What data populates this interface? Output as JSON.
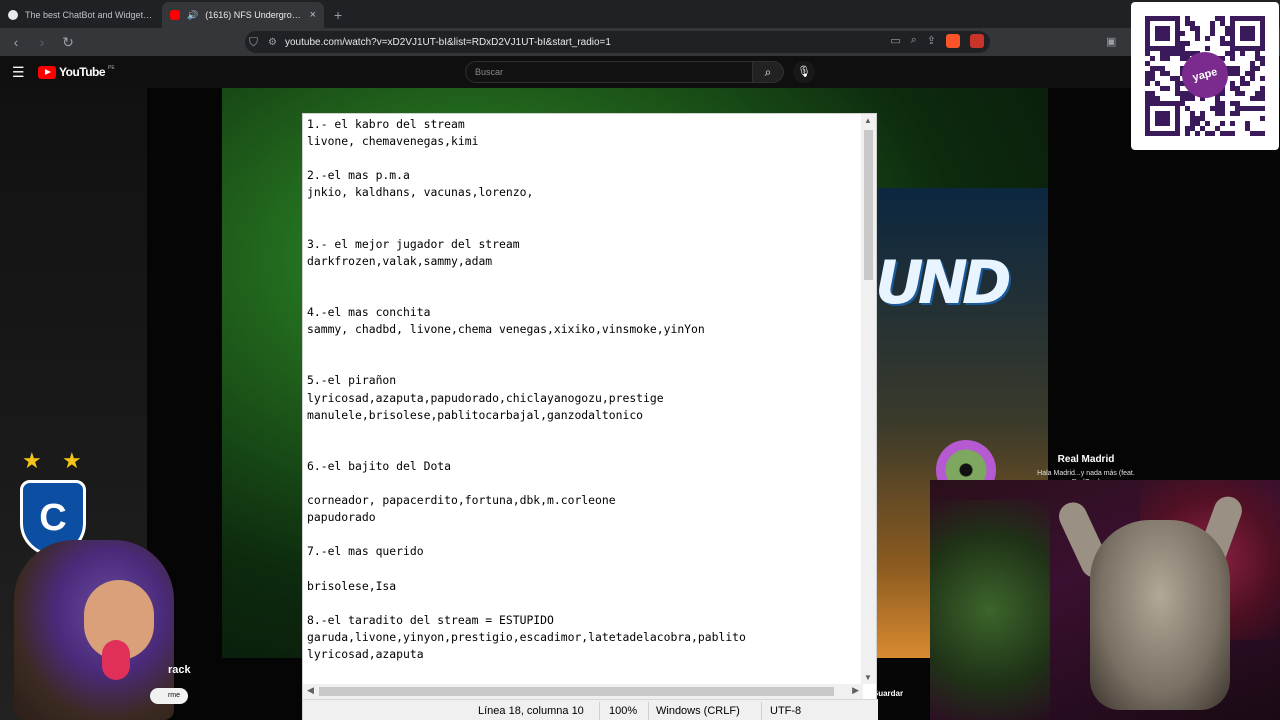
{
  "browser": {
    "tabs": [
      {
        "title": "The best ChatBot and Widgets for K",
        "favicon": "chatbot-icon"
      },
      {
        "title": "(1616) NFS Underground 2 -",
        "favicon": "youtube-icon",
        "audio": true
      }
    ],
    "new_tab": "+",
    "close": "×",
    "url": "youtube.com/watch?v=xD2VJ1UT-bI&list=RDxD2VJ1UT-bI&start_radio=1"
  },
  "youtube": {
    "logo_text": "YouTube",
    "logo_suffix": "PE",
    "search_placeholder": "Buscar"
  },
  "notepad": {
    "lines": [
      "1.- el kabro del stream",
      "livone, chemavenegas,kimi",
      "",
      "2.-el mas p.m.a",
      "jnkio, kaldhans, vacunas,lorenzo,",
      "",
      "",
      "3.- el mejor jugador del stream",
      "darkfrozen,valak,sammy,adam",
      "",
      "",
      "4.-el mas conchita",
      "sammy, chadbd, livone,chema venegas,xixiko,vinsmoke,yinYon",
      "",
      "",
      "5.-el pirañon",
      "lyricosad,azaputa,papudorado,chiclayanogozu,prestige",
      "manulele,brisolese,pablitocarbajal,ganzodaltonico",
      "",
      "",
      "6.-el bajito del Dota",
      "",
      "corneador, papacerdito,fortuna,dbk,m.corleone",
      "papudorado",
      "",
      "7.-el mas querido",
      "",
      "brisolese,Isa",
      "",
      "8.-el taradito del stream = ESTUPIDO",
      "garuda,livone,yinyon,prestigio,escadimor,latetadelacobra,pablito",
      "lyricosad,azaputa"
    ],
    "status": {
      "position": "Línea 18, columna 10",
      "zoom": "100%",
      "line_ending": "Windows (CRLF)",
      "encoding": "UTF-8"
    }
  },
  "overlay": {
    "qr_brand": "yape",
    "now_playing": {
      "title": "Real Madrid",
      "subtitle": "Hala Madrid...y nada más (feat. RedOne)"
    },
    "track_label": "rack",
    "subscribe_label": "rme",
    "save_label": "Guardar"
  }
}
